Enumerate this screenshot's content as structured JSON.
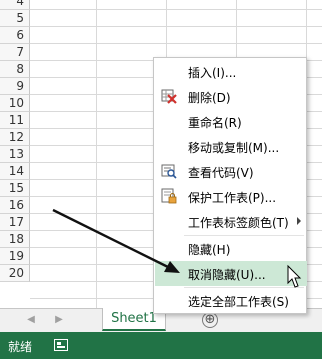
{
  "rows": [
    "4",
    "5",
    "6",
    "7",
    "8",
    "9",
    "10",
    "11",
    "12",
    "13",
    "14",
    "15",
    "16",
    "17",
    "18",
    "19",
    "20"
  ],
  "sheet_tab": "Sheet1",
  "add_sheet": "⊕",
  "status": {
    "text": "就绪"
  },
  "menu": {
    "items": [
      {
        "label": "插入(I)..."
      },
      {
        "label": "删除(D)"
      },
      {
        "label": "重命名(R)"
      },
      {
        "label": "移动或复制(M)..."
      },
      {
        "label": "查看代码(V)"
      },
      {
        "label": "保护工作表(P)..."
      },
      {
        "label": "工作表标签颜色(T)"
      },
      {
        "label": "隐藏(H)"
      },
      {
        "label": "取消隐藏(U)..."
      },
      {
        "label": "选定全部工作表(S)"
      }
    ]
  },
  "colors": {
    "accent": "#217346",
    "highlight": "#cde8d6"
  },
  "icons": [
    "delete-sheet-icon",
    "view-code-icon",
    "protect-sheet-icon",
    "submenu-arrow-icon",
    "mouse-cursor-icon",
    "add-sheet-icon"
  ]
}
